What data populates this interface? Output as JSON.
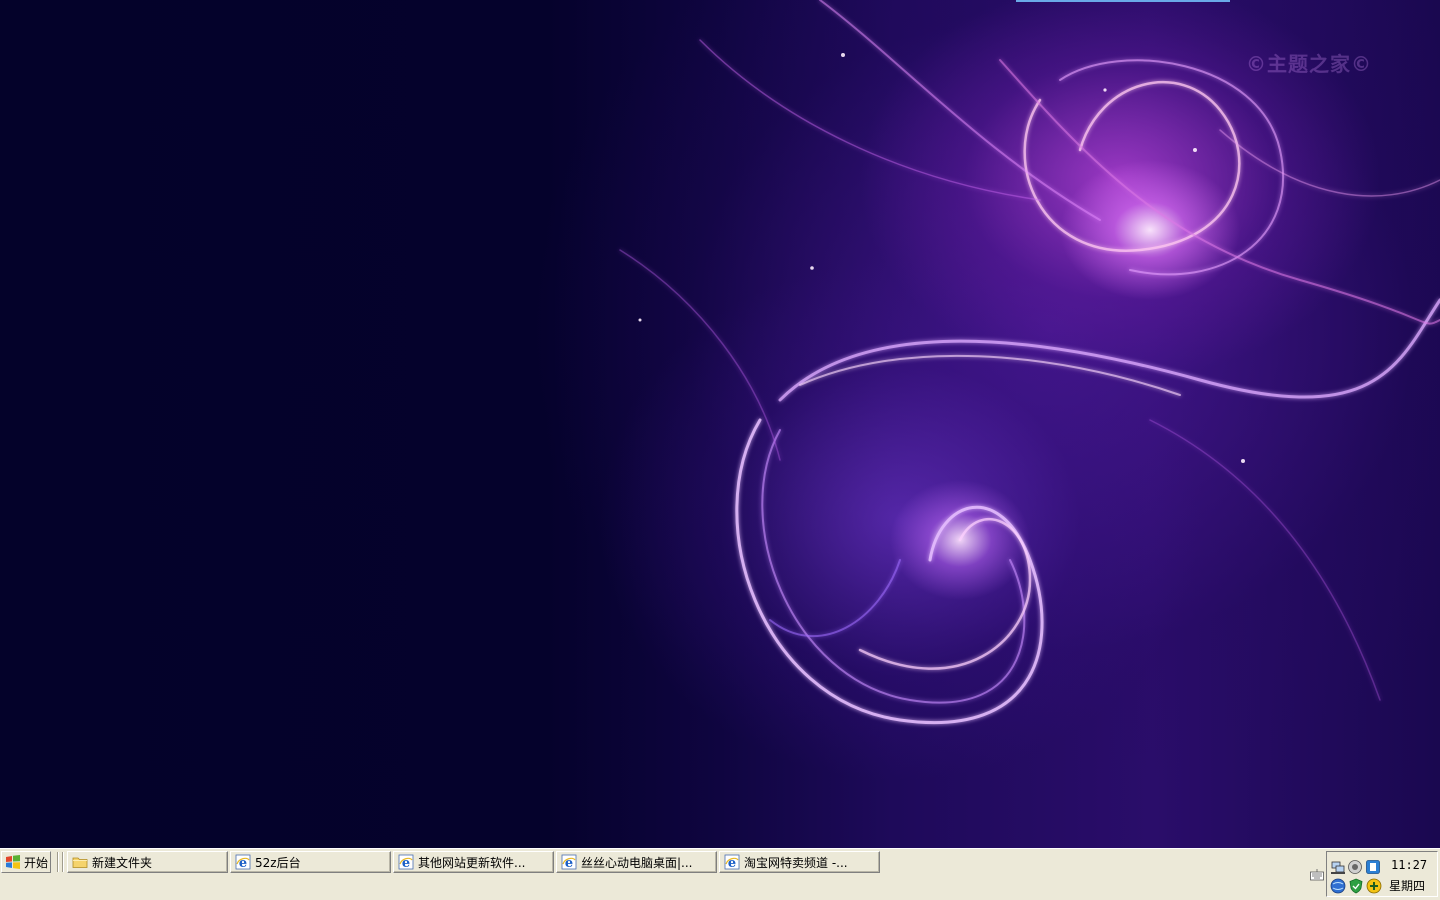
{
  "desktop": {
    "wallpaper": "purple-fractal-swirl",
    "watermark": "©主题之家©"
  },
  "taskbar": {
    "start": {
      "label": "开始",
      "icon": "windows-flag-icon"
    },
    "tasks": [
      {
        "label": "新建文件夹",
        "icon": "folder-icon"
      },
      {
        "label": "52z后台",
        "icon": "ie-icon"
      },
      {
        "label": "其他网站更新软件...",
        "icon": "ie-icon"
      },
      {
        "label": "丝丝心动电脑桌面|...",
        "icon": "ie-icon"
      },
      {
        "label": "淘宝网特卖频道 -...",
        "icon": "ie-icon"
      }
    ],
    "tray": {
      "icons": [
        "network-icon",
        "speaker-icon",
        "app-icon",
        "globe-icon",
        "shield-icon",
        "plus-icon"
      ],
      "time": "11:27",
      "day": "星期四"
    }
  },
  "colors": {
    "taskbar_bg": "#ece9d8",
    "desktop_dark": "#05022a",
    "accent_purple": "#c060f0"
  }
}
